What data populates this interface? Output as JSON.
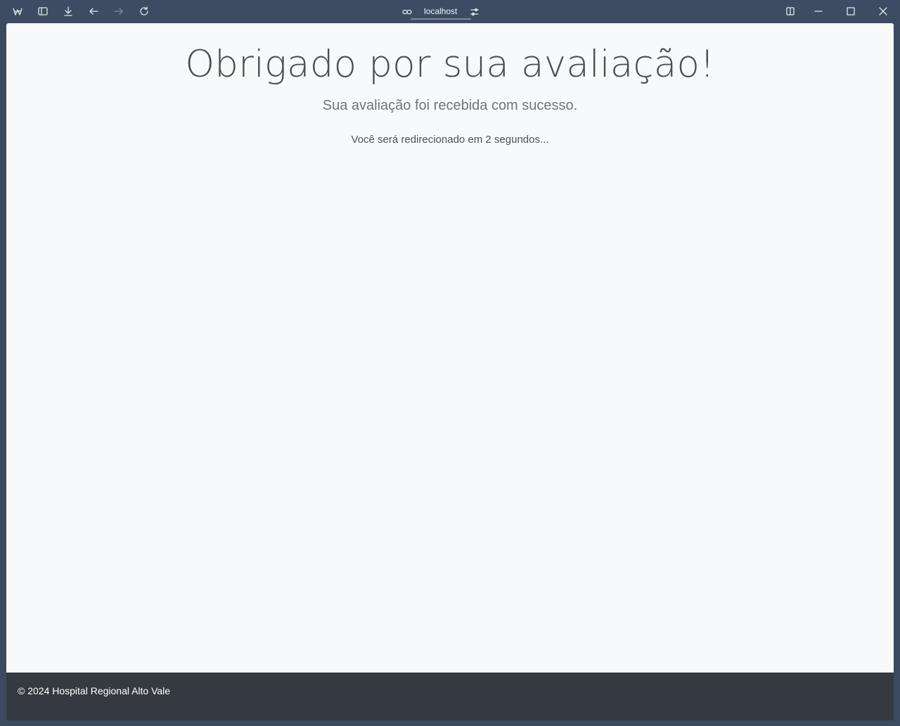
{
  "browser": {
    "url": "localhost",
    "icons": [
      "browser-logo-icon",
      "sidebar-icon",
      "download-icon",
      "back-icon",
      "forward-icon",
      "reload-icon",
      "link-icon",
      "site-settings-icon",
      "split-view-icon",
      "minimize-icon",
      "maximize-icon",
      "close-icon"
    ]
  },
  "page": {
    "heading": "Obrigado por sua avaliação!",
    "subheading": "Sua avaliação foi recebida com sucesso.",
    "redirect_message": "Você será redirecionado em 2 segundos..."
  },
  "footer": {
    "text": "© 2024 Hospital Regional Alto Vale"
  },
  "colors": {
    "titlebar": "#3d4c63",
    "page_background": "#f8f9fa",
    "footer_background": "#343a40"
  }
}
